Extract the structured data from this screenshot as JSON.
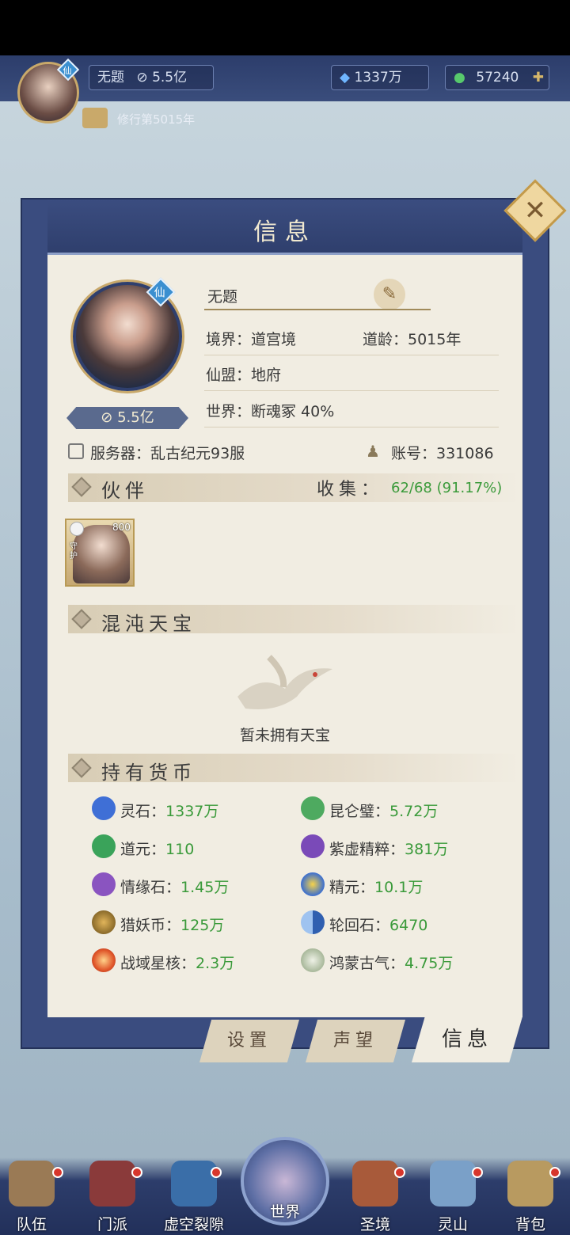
{
  "top": {
    "player_name": "无题",
    "power": "5.5亿",
    "lingshi": "1337万",
    "jade": "57240",
    "cultivation": "修行第5015年",
    "badge": "仙"
  },
  "panel": {
    "title": "信息",
    "name": "无题",
    "badge": "仙",
    "power": "5.5亿",
    "realm": "境界：道宫境",
    "age": "道龄：5015年",
    "alliance": "仙盟：地府",
    "world": "世界：断魂冢  40%",
    "server": "服务器：乱古纪元93服",
    "account": "账号：331086"
  },
  "partners": {
    "title": "伙伴",
    "collect_label": "收集：",
    "collect_value": "62/68 (91.17%)",
    "card": {
      "level": "800",
      "tag": "守护"
    }
  },
  "treasure": {
    "title": "混沌天宝",
    "empty": "暂未拥有天宝"
  },
  "currency": {
    "title": "持有货币",
    "items": [
      {
        "label": "灵石：",
        "value": "1337万",
        "icon": "crystal-icon",
        "color": "#3f6fd6"
      },
      {
        "label": "昆仑璧：",
        "value": "5.72万",
        "icon": "jade-disc-icon",
        "color": "#4eaa60"
      },
      {
        "label": "道元：",
        "value": "110",
        "icon": "green-crystal-icon",
        "color": "#3aa35a"
      },
      {
        "label": "紫虚精粹：",
        "value": "381万",
        "icon": "purple-crystal-icon",
        "color": "#7a4ab8"
      },
      {
        "label": "情缘石：",
        "value": "1.45万",
        "icon": "purple-stone-icon",
        "color": "#8a54c0"
      },
      {
        "label": "精元：",
        "value": "10.1万",
        "icon": "essence-orb-icon",
        "color": "#3a6ed0"
      },
      {
        "label": "猎妖币：",
        "value": "125万",
        "icon": "bronze-coin-icon",
        "color": "#8a6a2a"
      },
      {
        "label": "轮回石：",
        "value": "6470",
        "icon": "yin-yang-icon",
        "color": "#2f5fb0"
      },
      {
        "label": "战域星核：",
        "value": "2.3万",
        "icon": "star-core-icon",
        "color": "#e0562a"
      },
      {
        "label": "鸿蒙古气：",
        "value": "4.75万",
        "icon": "mist-icon",
        "color": "#a8b89a"
      }
    ]
  },
  "tabs": [
    "设置",
    "声望",
    "信息"
  ],
  "nav": [
    "队伍",
    "门派",
    "虚空裂隙",
    "世界",
    "圣境",
    "灵山",
    "背包"
  ]
}
